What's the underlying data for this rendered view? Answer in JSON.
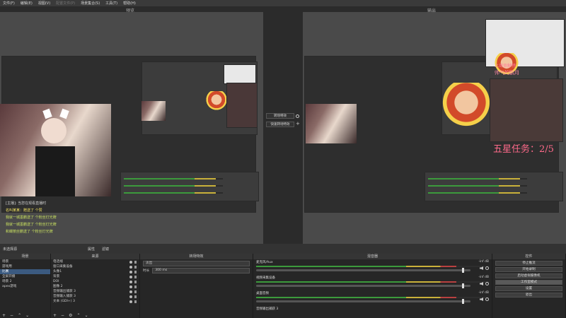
{
  "menu": {
    "items": [
      "文件(F)",
      "编辑(E)",
      "视图(V)",
      "配置文件(P)",
      "场景集合(S)",
      "工具(T)",
      "帮助(H)"
    ],
    "dim_index": 3
  },
  "labels": {
    "preview": "预览",
    "program": "输出"
  },
  "transition": {
    "button": "转场特效",
    "quick": "快速转场特效"
  },
  "overlay": {
    "title_line1": "上周贡献榜",
    "title_line2": "帅气的鹏月",
    "star_task": "五星任务：2/5"
  },
  "chat": {
    "lines": [
      {
        "text": "[主播]: 当您在观看直播时",
        "color": "#d0d0d0"
      },
      {
        "text": "名叫某某：赠送了 个赞",
        "color": "#f0e060"
      },
      {
        "text": "我就一城墨鹏送了 个粉丝灯光牌",
        "color": "#c8e060"
      },
      {
        "text": "我就一城墨鹏送了 个粉丝灯光牌",
        "color": "#c8e060"
      },
      {
        "text": "和蝶丽丝鹏送了 个粉丝灯光牌",
        "color": "#c8e060"
      }
    ]
  },
  "dockbar": {
    "left": "未选择源",
    "props": "属性",
    "filters": "滤镜"
  },
  "scenes": {
    "title": "场景",
    "items": [
      "场景",
      "游戏用",
      "比赛",
      "全屏开播",
      "场景 2",
      "apex游戏"
    ],
    "selected": 2
  },
  "sources": {
    "title": "来源",
    "items": [
      "电话线",
      "窗口采集设备",
      "头像1",
      "背景",
      "DOI",
      "图像 2",
      "音频输出捕获 3",
      "音频输入捕获 3",
      "文本 (GDI+) 3"
    ]
  },
  "transitions_dock": {
    "title": "转场特效",
    "type": "淡出",
    "duration_label": "时长",
    "duration_value": "300 ms"
  },
  "mixer": {
    "title": "混音器",
    "channels": [
      {
        "name": "麦克风/Aux",
        "db": "-inf dB",
        "level": 0.0
      },
      {
        "name": "视频采集设备",
        "db": "-inf dB",
        "level": 0.0
      },
      {
        "name": "桌面音频",
        "db": "-inf dB",
        "level": 0.0
      },
      {
        "name": "音频输出捕获 3",
        "db": "",
        "level": 0.0
      }
    ]
  },
  "controls": {
    "title": "控件",
    "buttons": [
      "停止推流",
      "开始录制",
      "启动虚拟摄像机",
      "工作室模式",
      "设置",
      "退出"
    ],
    "active_index": 3
  },
  "colors": {
    "accent": "#3b5a80",
    "meter_green": "#3c9a3c",
    "meter_yellow": "#c9b13a"
  }
}
